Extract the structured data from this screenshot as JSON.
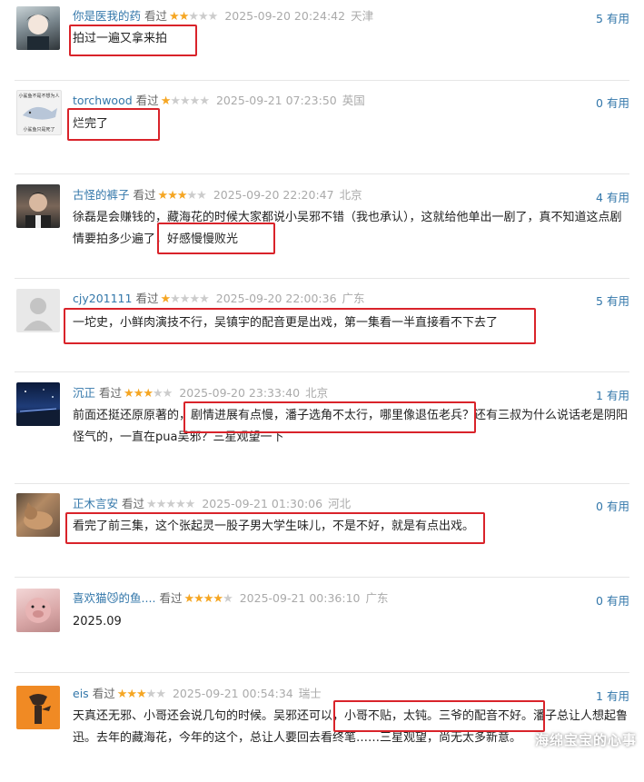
{
  "watermark": "海绵宝宝的心事",
  "useful_label": "有用",
  "reviews": [
    {
      "user": "你是医我的药",
      "status": "看过",
      "stars": 2,
      "time": "2025-09-20 20:24:42",
      "location": "天津",
      "useful": "5",
      "content": "拍过一遍又拿来拍"
    },
    {
      "user": "torchwood",
      "status": "看过",
      "stars": 1,
      "time": "2025-09-21 07:23:50",
      "location": "英国",
      "useful": "0",
      "content": "烂完了",
      "avatar_text": "小鲨鱼不是不想为人",
      "avatar_text2": "小鲨鱼只是死了"
    },
    {
      "user": "古怪的裤子",
      "status": "看过",
      "stars": 3,
      "time": "2025-09-20 22:20:47",
      "location": "北京",
      "useful": "4",
      "content": "徐磊是会赚钱的，藏海花的时候大家都说小吴邪不错（我也承认），这就给他单出一剧了，真不知道这点剧情要拍多少遍了，好感慢慢败光"
    },
    {
      "user": "cjy201111",
      "status": "看过",
      "stars": 1,
      "time": "2025-09-20 22:00:36",
      "location": "广东",
      "useful": "5",
      "content": "一坨史，小鲜肉演技不行，吴镇宇的配音更是出戏，第一集看一半直接看不下去了"
    },
    {
      "user": "沉正",
      "status": "看过",
      "stars": 3,
      "time": "2025-09-20 23:33:40",
      "location": "北京",
      "useful": "1",
      "content": "前面还挺还原原著的，剧情进展有点慢，潘子选角不太行，哪里像退伍老兵？还有三叔为什么说话老是阴阳怪气的，一直在pua吴邪？三星观望一下"
    },
    {
      "user": "正木言安",
      "status": "看过",
      "stars": 0,
      "time": "2025-09-21 01:30:06",
      "location": "河北",
      "useful": "0",
      "content": "看完了前三集，这个张起灵一股子男大学生味儿，不是不好，就是有点出戏。"
    },
    {
      "user": "喜欢猫😼的鱼....",
      "status": "看过",
      "stars": 4,
      "time": "2025-09-21 00:36:10",
      "location": "广东",
      "useful": "0",
      "content": "2025.09"
    },
    {
      "user": "eis",
      "status": "看过",
      "stars": 3,
      "time": "2025-09-21 00:54:34",
      "location": "瑞士",
      "useful": "1",
      "content": "天真还无邪、小哥还会说几句的时候。吴邪还可以，小哥不贴，太钝。三爷的配音不好。潘子总让人想起鲁迅。去年的藏海花，今年的这个，总让人要回去看终笔……三星观望，尚无太多新意。"
    }
  ]
}
